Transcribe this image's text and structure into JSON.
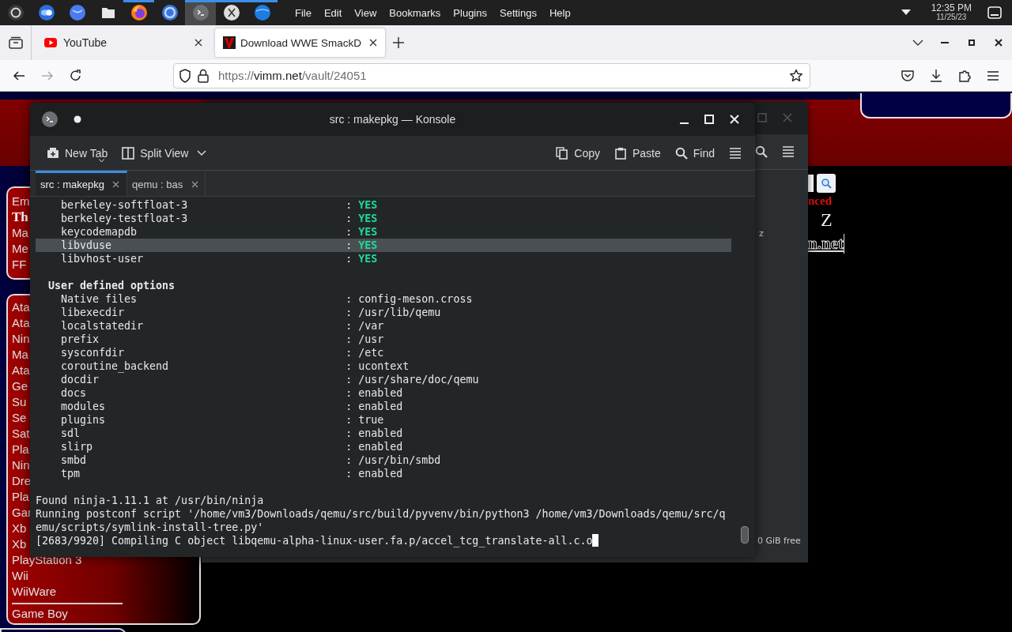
{
  "panel": {
    "apps": [
      {
        "kind": "ring",
        "running": false,
        "selected": false
      },
      {
        "kind": "toggle",
        "running": false,
        "selected": false
      },
      {
        "kind": "globe",
        "running": false,
        "selected": false
      },
      {
        "kind": "folder",
        "running": false,
        "selected": false
      },
      {
        "kind": "flame",
        "running": true,
        "selected": false
      },
      {
        "kind": "orb",
        "running": false,
        "selected": false
      },
      {
        "kind": "terminal",
        "running": true,
        "selected": true
      },
      {
        "kind": "xmark",
        "running": true,
        "selected": false
      },
      {
        "kind": "bubble",
        "running": true,
        "selected": false
      }
    ],
    "menu": [
      "File",
      "Edit",
      "View",
      "Bookmarks",
      "Plugins",
      "Settings",
      "Help"
    ],
    "clock": {
      "time": "12:35 PM",
      "date": "11/25/23"
    }
  },
  "browser": {
    "tabs": [
      {
        "title": "YouTube",
        "kind": "play",
        "selected": false
      },
      {
        "title": "Download WWE SmackD",
        "kind": "logo",
        "selected": true
      }
    ],
    "nav": [
      {
        "kind": "back",
        "disabled": false
      },
      {
        "kind": "forward",
        "disabled": true
      },
      {
        "kind": "reload",
        "disabled": false
      }
    ],
    "url_parts": [
      "https://",
      "vimm.net",
      "/vault/24051"
    ]
  },
  "web_page": {
    "sidebar_top": [
      {
        "label": "Em",
        "selected": false
      },
      {
        "label": "Th",
        "selected": true
      },
      {
        "label": "Ma",
        "selected": false
      },
      {
        "label": "Me",
        "selected": false
      },
      {
        "label": "FF",
        "selected": false
      }
    ],
    "sidebar_list": [
      "Ata",
      "Ata",
      "Nin",
      "Ma",
      "Ata",
      "Ge",
      "Su",
      "Se",
      "Sat",
      "Pla",
      "Nin",
      "Dre",
      "Pla",
      "Gar",
      "Xb",
      "Xb",
      "PlayStation 3",
      "Wii",
      "WiiWare"
    ],
    "sidebar_after_rule": "Game Boy",
    "search_label": "nced",
    "letter": "Z",
    "link": "n.net"
  },
  "back_window": {
    "content_text": "z",
    "status": "0 GiB free"
  },
  "konsole": {
    "title": "src : makepkg — Konsole",
    "toolbar_left": [
      {
        "kind": "new-tab",
        "label": "New Tab"
      },
      {
        "kind": "split",
        "label": "Split View"
      }
    ],
    "toolbar_right": [
      {
        "kind": "copy",
        "label": "Copy"
      },
      {
        "kind": "paste",
        "label": "Paste"
      },
      {
        "kind": "find",
        "label": "Find"
      }
    ],
    "tabs": [
      {
        "label": "src : makepkg",
        "selected": true
      },
      {
        "label": "qemu : bas",
        "selected": false
      }
    ],
    "lines": [
      {
        "kind": "flag",
        "key": "berkeley-softfloat-3",
        "colon": ":",
        "value": "YES",
        "highlighted": false
      },
      {
        "kind": "flag",
        "key": "berkeley-testfloat-3",
        "colon": ":",
        "value": "YES",
        "highlighted": false
      },
      {
        "kind": "flag",
        "key": "keycodemapdb",
        "colon": ":",
        "value": "YES",
        "highlighted": false
      },
      {
        "kind": "flag",
        "key": "libvduse",
        "colon": ":",
        "value": "YES",
        "highlighted": true
      },
      {
        "kind": "flag",
        "key": "libvhost-user",
        "colon": ":",
        "value": "YES",
        "highlighted": false
      },
      {
        "kind": "blank",
        "highlighted": false
      },
      {
        "kind": "heading",
        "text": "User defined options",
        "highlighted": false
      },
      {
        "kind": "option",
        "key": "Native files",
        "colon": ":",
        "value": "config-meson.cross",
        "highlighted": false
      },
      {
        "kind": "option",
        "key": "libexecdir",
        "colon": ":",
        "value": "/usr/lib/qemu",
        "highlighted": false
      },
      {
        "kind": "option",
        "key": "localstatedir",
        "colon": ":",
        "value": "/var",
        "highlighted": false
      },
      {
        "kind": "option",
        "key": "prefix",
        "colon": ":",
        "value": "/usr",
        "highlighted": false
      },
      {
        "kind": "option",
        "key": "sysconfdir",
        "colon": ":",
        "value": "/etc",
        "highlighted": false
      },
      {
        "kind": "option",
        "key": "coroutine_backend",
        "colon": ":",
        "value": "ucontext",
        "highlighted": false
      },
      {
        "kind": "option",
        "key": "docdir",
        "colon": ":",
        "value": "/usr/share/doc/qemu",
        "highlighted": false
      },
      {
        "kind": "option",
        "key": "docs",
        "colon": ":",
        "value": "enabled",
        "highlighted": false
      },
      {
        "kind": "option",
        "key": "modules",
        "colon": ":",
        "value": "enabled",
        "highlighted": false
      },
      {
        "kind": "option",
        "key": "plugins",
        "colon": ":",
        "value": "true",
        "highlighted": false
      },
      {
        "kind": "option",
        "key": "sdl",
        "colon": ":",
        "value": "enabled",
        "highlighted": false
      },
      {
        "kind": "option",
        "key": "slirp",
        "colon": ":",
        "value": "enabled",
        "highlighted": false
      },
      {
        "kind": "option",
        "key": "smbd",
        "colon": ":",
        "value": "/usr/bin/smbd",
        "highlighted": false
      },
      {
        "kind": "option",
        "key": "tpm",
        "colon": ":",
        "value": "enabled",
        "highlighted": false
      },
      {
        "kind": "blank",
        "highlighted": false
      },
      {
        "kind": "text",
        "text": "Found ninja-1.11.1 at /usr/bin/ninja",
        "highlighted": false
      },
      {
        "kind": "text",
        "text": "Running postconf script '/home/vm3/Downloads/qemu/src/build/pyvenv/bin/python3 /home/vm3/Downloads/qemu/src/qemu/scripts/symlink-install-tree.py'",
        "highlighted": false
      },
      {
        "kind": "prompt",
        "text": "[2683/9920] Compiling C object libqemu-alpha-linux-user.fa.p/accel_tcg_translate-all.c.o",
        "highlighted": false
      }
    ]
  }
}
